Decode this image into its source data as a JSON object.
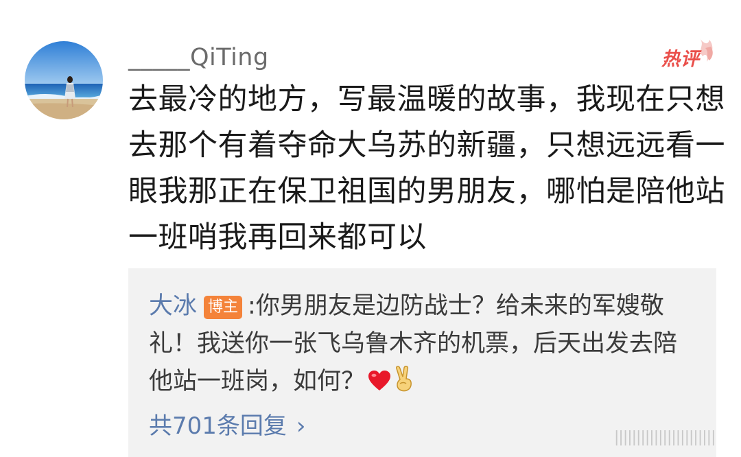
{
  "comment": {
    "username": "_____QiTing",
    "hot_label": "热评",
    "text": "去最冷的地方，写最温暖的故事，我现在只想去那个有着夺命大乌苏的新疆，只想远远看一眼我那正在保卫祖国的男朋友，哪怕是陪他站一班哨我再回来都可以"
  },
  "reply": {
    "author": "大冰",
    "author_badge": "博主",
    "separator": ":",
    "text": "你男朋友是边防战士？给未来的军嫂敬礼！我送你一张飞乌鲁木齐的机票，后天出发去陪他站一班岗，如何？",
    "emojis": [
      "red-heart-emoji",
      "victory-hand-emoji"
    ],
    "view_all_label": "共701条回复",
    "chevron": "›"
  },
  "watermark": "|||||||||||||||||||||||",
  "colors": {
    "link_blue": "#5b7bad",
    "hot_red": "#ea4f4a",
    "badge_orange": "#f4833a",
    "reply_bg": "#f2f2f2"
  }
}
